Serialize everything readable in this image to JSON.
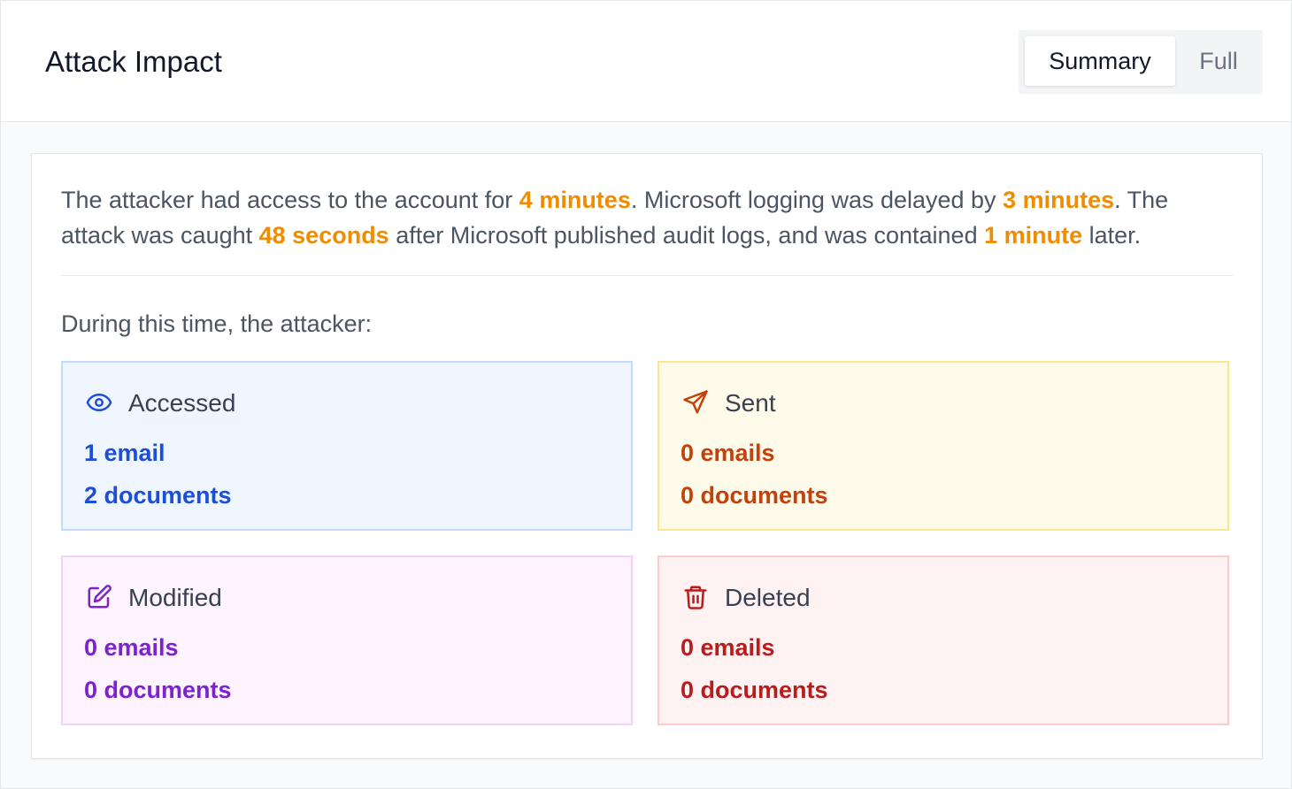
{
  "header": {
    "title": "Attack Impact",
    "view_toggle": {
      "options": [
        "Summary",
        "Full"
      ],
      "selected": "Summary"
    }
  },
  "summary": {
    "part1": "The attacker had access to the account for ",
    "access_duration": "4 minutes",
    "part2": ". Microsoft logging was delayed by ",
    "logging_delay": "3 minutes",
    "part3": ". The attack was caught ",
    "caught_after": "48 seconds",
    "part4": " after Microsoft published audit logs, and was contained ",
    "contained_after": "1 minute",
    "part5": " later."
  },
  "during_label": "During this time, the attacker:",
  "tiles": [
    {
      "title": "Accessed",
      "emails": "1 email",
      "documents": "2 documents",
      "icon": "eye-icon",
      "color": "#1d4ed8"
    },
    {
      "title": "Sent",
      "emails": "0 emails",
      "documents": "0 documents",
      "icon": "send-icon",
      "color": "#c2410c"
    },
    {
      "title": "Modified",
      "emails": "0 emails",
      "documents": "0 documents",
      "icon": "edit-icon",
      "color": "#7e22ce"
    },
    {
      "title": "Deleted",
      "emails": "0 emails",
      "documents": "0 documents",
      "icon": "trash-icon",
      "color": "#b91c1c"
    }
  ],
  "colors": {
    "highlight": "#f08c00"
  }
}
